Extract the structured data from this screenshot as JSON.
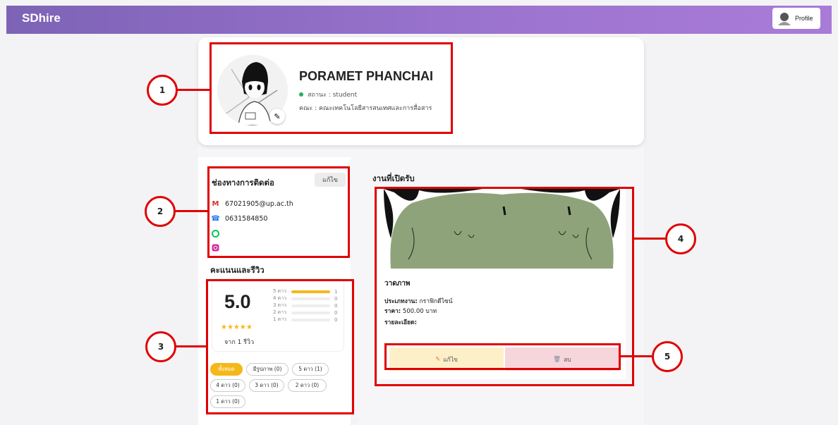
{
  "app": {
    "brand": "SDhire",
    "profile_label": "Profile"
  },
  "profile": {
    "name": "PORAMET PHANCHAI",
    "status": "สถานะ : student",
    "faculty": "คณะ : คณะเทคโนโลยีสารสนเทศและการสื่อสาร",
    "status_color": "#27ae60"
  },
  "contact": {
    "title": "ช่องทางการติดต่อ",
    "edit_label": "แก้ไข",
    "email": "67021905@up.ac.th",
    "phone": "0631584850",
    "line": "",
    "instagram": ""
  },
  "reviews": {
    "title": "คะแนนและรีวิว",
    "score": "5.0",
    "stars": "★★★★★",
    "from_text": "จาก 1 รีวิว",
    "breakdown": [
      {
        "label": "5 ดาว",
        "count": "1",
        "fraction": 1.0
      },
      {
        "label": "4 ดาว",
        "count": "0",
        "fraction": 0
      },
      {
        "label": "3 ดาว",
        "count": "0",
        "fraction": 0
      },
      {
        "label": "2 ดาว",
        "count": "0",
        "fraction": 0
      },
      {
        "label": "1 ดาว",
        "count": "0",
        "fraction": 0
      }
    ],
    "filters": [
      "ทั้งหมด",
      "มีรูปภาพ (0)",
      "5 ดาว (1)",
      "4 ดาว (0)",
      "3 ดาว (0)",
      "2 ดาว (0)",
      "1 ดาว (0)"
    ],
    "active_filter": "ทั้งหมด"
  },
  "jobs": {
    "title": "งานที่เปิดรับ",
    "items": [
      {
        "name": "วาดภาพ",
        "type_label": "ประเภทงาน:",
        "type_value": "กราฟิกดีไซน์",
        "price_label": "ราคา:",
        "price_value": "500.00 บาท",
        "detail_label": "รายละเอียด:",
        "edit_label": "แก้ไข",
        "delete_label": "ลบ"
      }
    ]
  },
  "annotations": [
    "1",
    "2",
    "3",
    "4",
    "5"
  ],
  "colors": {
    "accent": "#9c74cf",
    "star": "#f5b81a",
    "annotation": "#e00000"
  }
}
